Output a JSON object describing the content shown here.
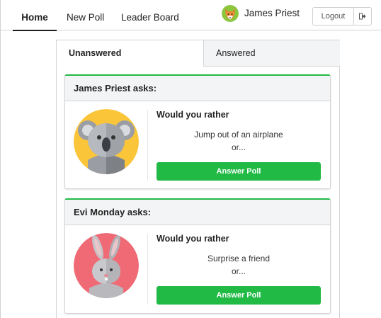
{
  "nav": {
    "items": [
      {
        "label": "Home",
        "active": true
      },
      {
        "label": "New Poll",
        "active": false
      },
      {
        "label": "Leader Board",
        "active": false
      }
    ],
    "user_name": "James Priest",
    "logout_label": "Logout",
    "user_avatar_icon": "fox-avatar-icon",
    "logout_icon": "sign-out-icon"
  },
  "tabs": [
    {
      "label": "Unanswered",
      "active": true
    },
    {
      "label": "Answered",
      "active": false
    }
  ],
  "polls": [
    {
      "asker": "James Priest asks:",
      "avatar_icon": "koala-avatar-icon",
      "heading": "Would you rather",
      "option_one": "Jump out of an airplane",
      "or_text": "or...",
      "button_label": "Answer Poll"
    },
    {
      "asker": "Evi Monday asks:",
      "avatar_icon": "rabbit-avatar-icon",
      "heading": "Would you rather",
      "option_one": "Surprise a friend",
      "or_text": "or...",
      "button_label": "Answer Poll"
    }
  ],
  "colors": {
    "accent_green": "#21ba45",
    "koala_bg": "#fbc53a",
    "rabbit_bg": "#f06a76"
  }
}
